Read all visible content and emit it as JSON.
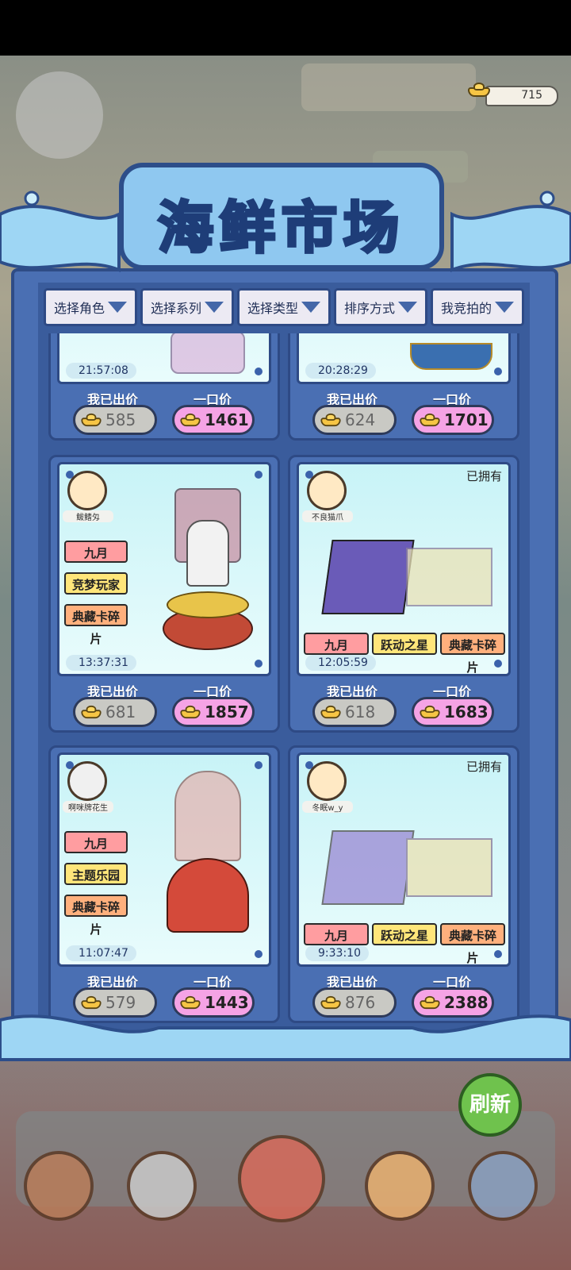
{
  "header": {
    "coins": "715",
    "title": "海鲜市场"
  },
  "filters": [
    {
      "label": "选择角色"
    },
    {
      "label": "选择系列"
    },
    {
      "label": "选择类型"
    },
    {
      "label": "排序方式"
    },
    {
      "label": "我竞拍的"
    }
  ],
  "labels": {
    "my_bid": "我已出价",
    "buy_now": "一口价",
    "owned": "已拥有"
  },
  "cards": [
    {
      "timer": "21:57:08",
      "my_bid": "585",
      "buy_now": "1461"
    },
    {
      "timer": "20:28:29",
      "my_bid": "624",
      "buy_now": "1701"
    },
    {
      "nick": "鲅鳍匁",
      "tags": [
        "九月",
        "竞梦玩家",
        "典藏卡碎片"
      ],
      "timer": "13:37:31",
      "my_bid": "681",
      "buy_now": "1857"
    },
    {
      "nick": "不良猫爪",
      "owned": true,
      "tags": [
        "九月",
        "跃动之星",
        "典藏卡碎片"
      ],
      "timer": "12:05:59",
      "my_bid": "618",
      "buy_now": "1683"
    },
    {
      "nick": "啊咪牌花生",
      "tags": [
        "九月",
        "主题乐园",
        "典藏卡碎片"
      ],
      "timer": "11:07:47",
      "my_bid": "579",
      "buy_now": "1443"
    },
    {
      "nick": "冬眠w_y",
      "owned": true,
      "tags": [
        "九月",
        "跃动之星",
        "典藏卡碎片"
      ],
      "timer": "9:33:10",
      "my_bid": "876",
      "buy_now": "2388"
    }
  ],
  "refresh_label": "刷新"
}
